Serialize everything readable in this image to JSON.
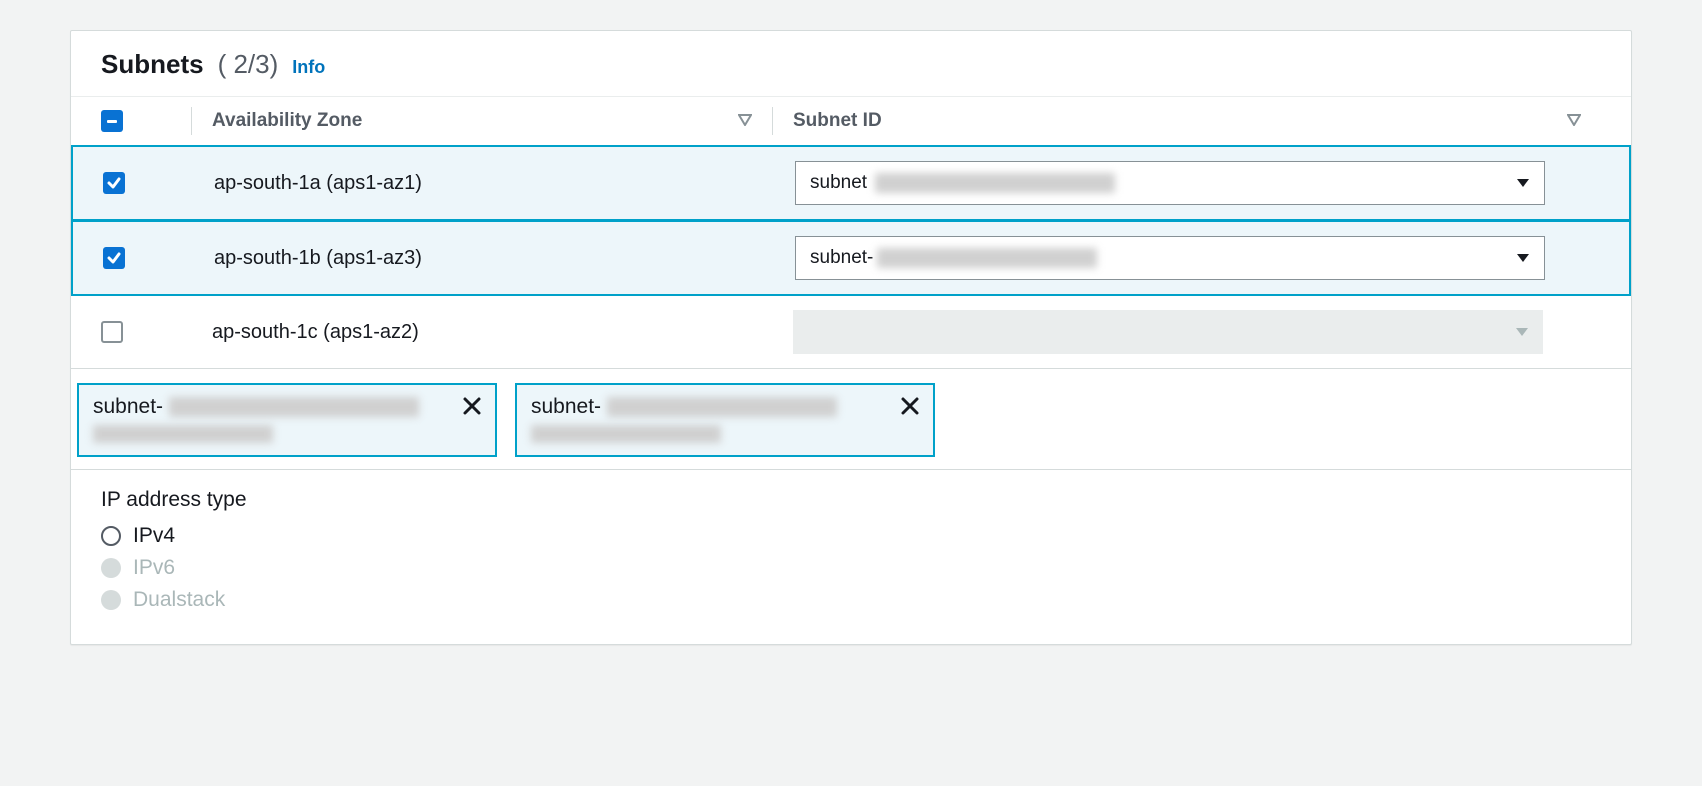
{
  "header": {
    "title": "Subnets",
    "count": "( 2/3)",
    "info": "Info"
  },
  "columns": {
    "az": "Availability Zone",
    "subnet": "Subnet ID"
  },
  "rows": [
    {
      "checked": true,
      "az": "ap-south-1a (aps1-az1)",
      "subnet_prefix": "subnet",
      "disabled": false
    },
    {
      "checked": true,
      "az": "ap-south-1b (aps1-az3)",
      "subnet_prefix": "subnet-",
      "disabled": false
    },
    {
      "checked": false,
      "az": "ap-south-1c (aps1-az2)",
      "subnet_prefix": "",
      "disabled": true
    }
  ],
  "chips": [
    {
      "prefix": "subnet-"
    },
    {
      "prefix": "subnet-"
    }
  ],
  "ip": {
    "title": "IP address type",
    "options": [
      {
        "label": "IPv4",
        "enabled": true
      },
      {
        "label": "IPv6",
        "enabled": false
      },
      {
        "label": "Dualstack",
        "enabled": false
      }
    ]
  }
}
